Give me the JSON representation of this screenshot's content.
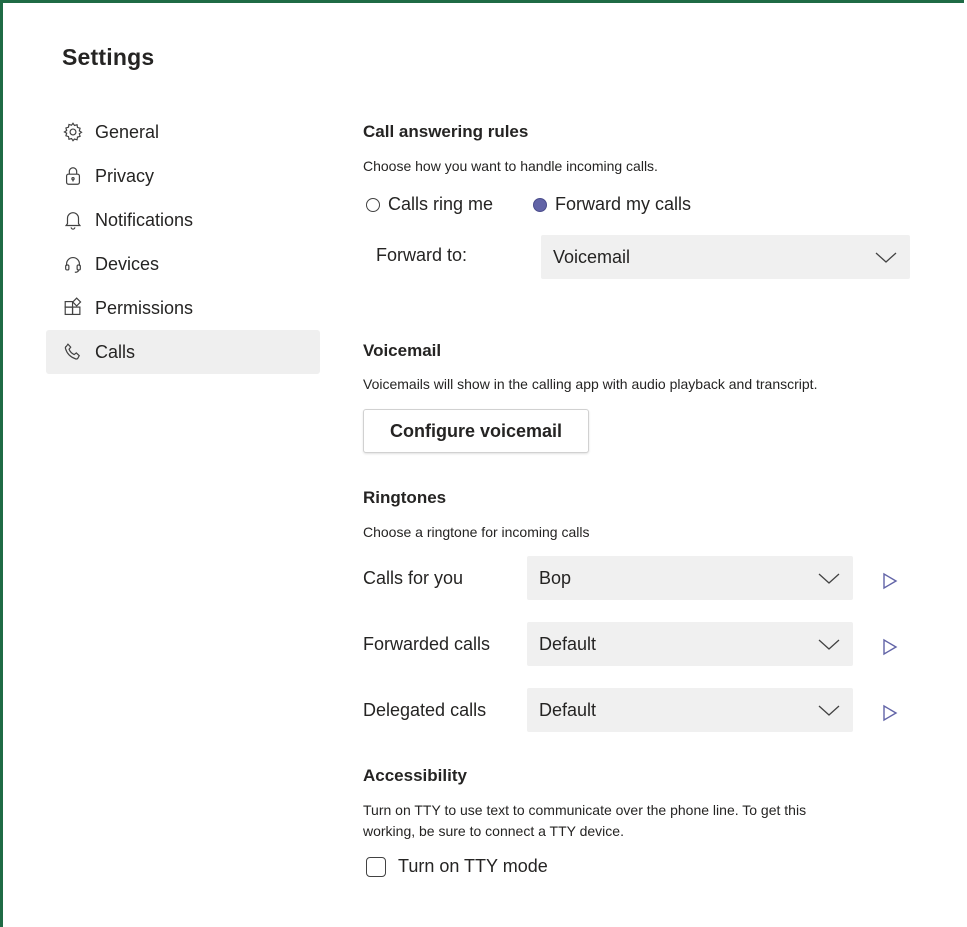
{
  "page": {
    "title": "Settings",
    "accent": "#6264a7",
    "frame_color": "#1f6b45"
  },
  "sidebar": {
    "items": [
      {
        "label": "General",
        "icon": "gear-icon"
      },
      {
        "label": "Privacy",
        "icon": "lock-icon"
      },
      {
        "label": "Notifications",
        "icon": "bell-icon"
      },
      {
        "label": "Devices",
        "icon": "headset-icon"
      },
      {
        "label": "Permissions",
        "icon": "apps-icon"
      },
      {
        "label": "Calls",
        "icon": "phone-icon",
        "active": true
      }
    ]
  },
  "call_answering": {
    "heading": "Call answering rules",
    "description": "Choose how you want to handle incoming calls.",
    "option_ring": "Calls ring me",
    "option_forward": "Forward my calls",
    "selected": "Forward my calls",
    "forward_label": "Forward to:",
    "forward_value": "Voicemail"
  },
  "voicemail": {
    "heading": "Voicemail",
    "description": "Voicemails will show in the calling app with audio playback and transcript.",
    "button_label": "Configure voicemail"
  },
  "ringtones": {
    "heading": "Ringtones",
    "description": "Choose a ringtone for incoming calls",
    "rows": [
      {
        "label": "Calls for you",
        "value": "Bop"
      },
      {
        "label": "Forwarded calls",
        "value": "Default"
      },
      {
        "label": "Delegated calls",
        "value": "Default"
      }
    ]
  },
  "accessibility": {
    "heading": "Accessibility",
    "description_line1": "Turn on TTY to use text to communicate over the phone line. To get this",
    "description_line2": "working, be sure to connect a TTY device.",
    "checkbox_label": "Turn on TTY mode",
    "checked": false
  }
}
